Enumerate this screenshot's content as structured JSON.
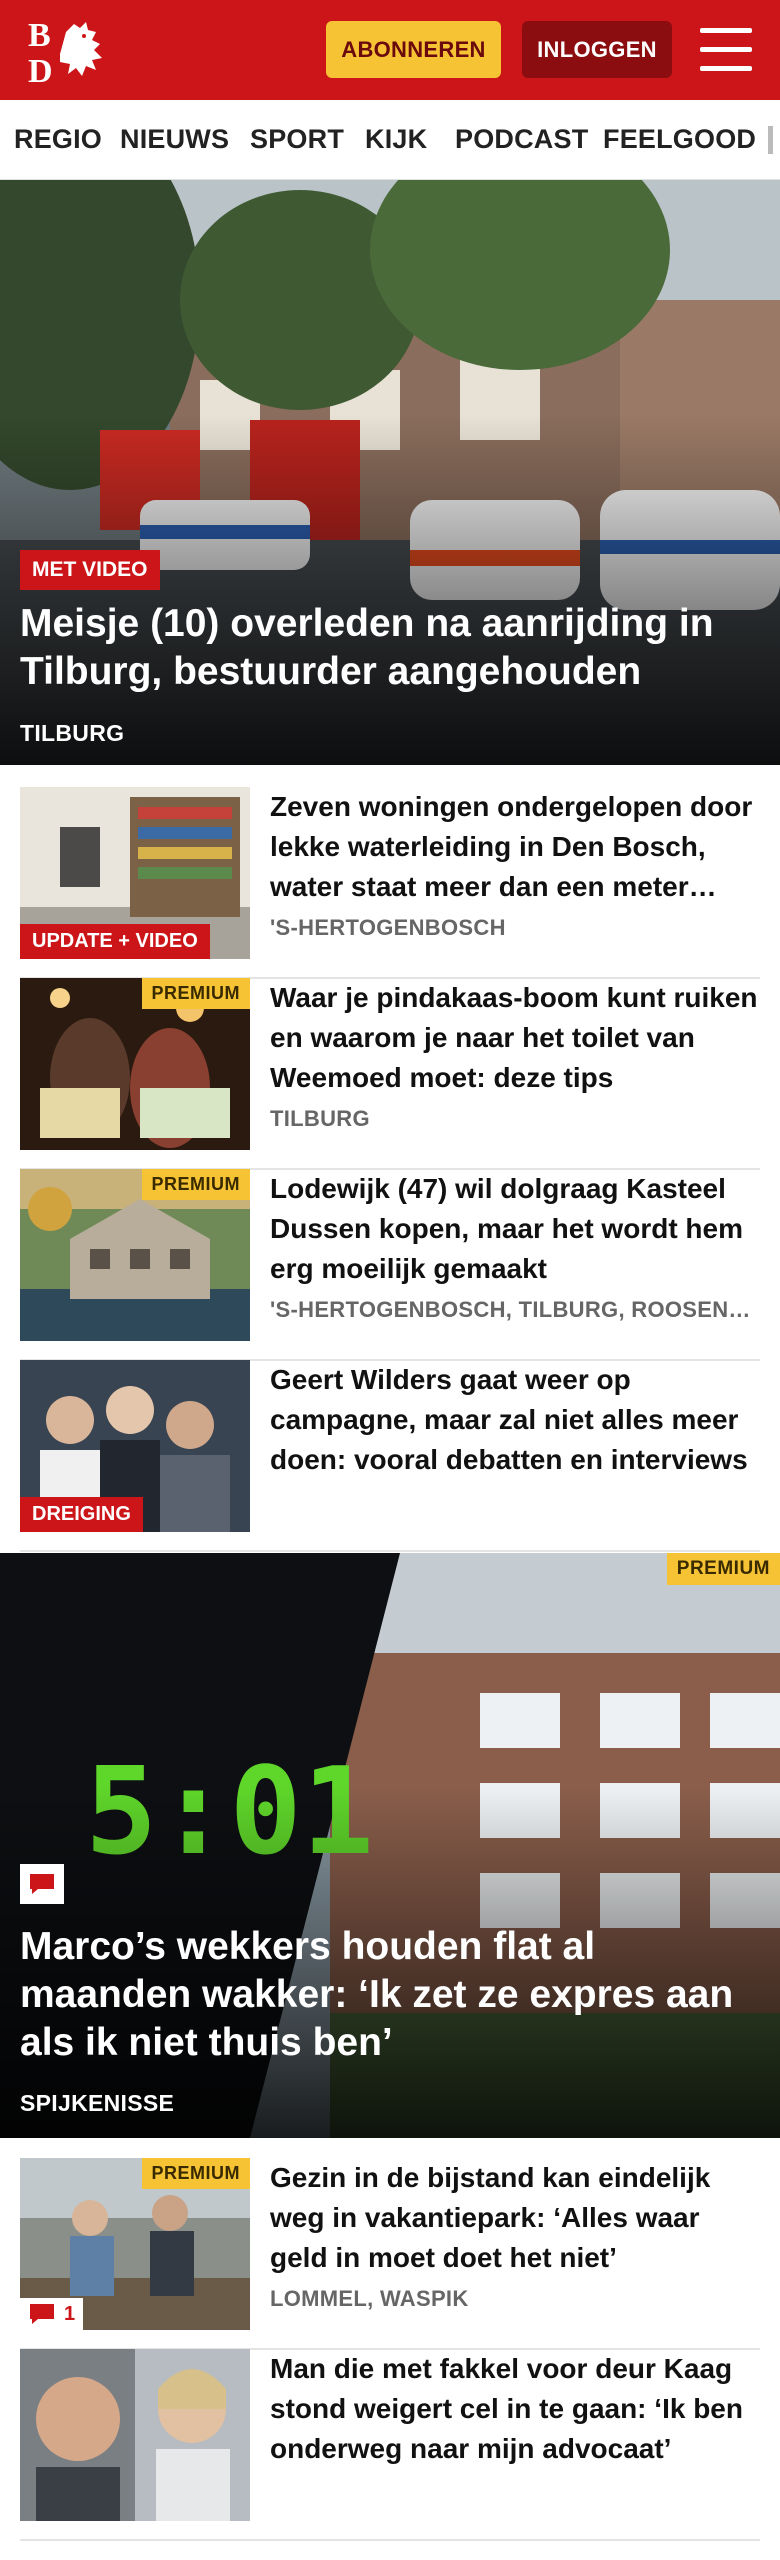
{
  "header": {
    "subscribe_label": "ABONNEREN",
    "login_label": "INLOGGEN",
    "logo_text": "BD"
  },
  "nav": {
    "items": [
      "REGIO",
      "NIEUWS",
      "SPORT",
      "KIJK",
      "PODCAST",
      "FEELGOOD"
    ]
  },
  "hero1": {
    "badge": "MET VIDEO",
    "title": "Meisje (10) overleden na aanrijding in Tilburg, bestuurder aangehouden",
    "location": "TILBURG"
  },
  "articles": [
    {
      "title": "Zeven woningen ondergelopen door lekke waterleiding in Den Bosch, water staat meer dan een meter hoog",
      "location": "'S-HERTOGENBOSCH",
      "badge": "UPDATE + VIDEO"
    },
    {
      "title": "Waar je pindakaas-boom kunt ruiken en waarom je naar het toilet van Weemoed moet: deze tips",
      "location": "TILBURG",
      "premium": "PREMIUM"
    },
    {
      "title": "Lodewijk (47) wil dolgraag Kasteel Dussen kopen, maar het wordt hem erg moeilijk gemaakt",
      "location": "'S-HERTOGENBOSCH, TILBURG, ROOSENDAAL",
      "premium": "PREMIUM"
    },
    {
      "title": "Geert Wilders gaat weer op campagne, maar zal niet alles meer doen: vooral debatten en interviews",
      "location": "",
      "badge": "DREIGING"
    }
  ],
  "hero2": {
    "premium": "PREMIUM",
    "title": "Marco’s wekkers houden flat al maanden wakker: ‘Ik zet ze expres aan als ik niet thuis ben’",
    "location": "SPIJKENISSE",
    "clock": "5:01"
  },
  "articles2": [
    {
      "title": "Gezin in de bijstand kan eindelijk weg in vakantiepark: ‘Alles waar geld in moet doet het niet’",
      "location": "LOMMEL, WASPIK",
      "premium": "PREMIUM",
      "comments": "1"
    },
    {
      "title": "Man die met fakkel voor deur Kaag stond weigert cel in te gaan: ‘Ik ben onderweg naar mijn advocaat’",
      "location": ""
    }
  ],
  "colors": {
    "brand_red": "#cc1519",
    "premium_yellow": "#f6c334",
    "login_dark_red": "#8c0d10"
  },
  "icons": [
    "logo-dragon-icon",
    "hamburger-menu-icon",
    "comment-icon"
  ]
}
